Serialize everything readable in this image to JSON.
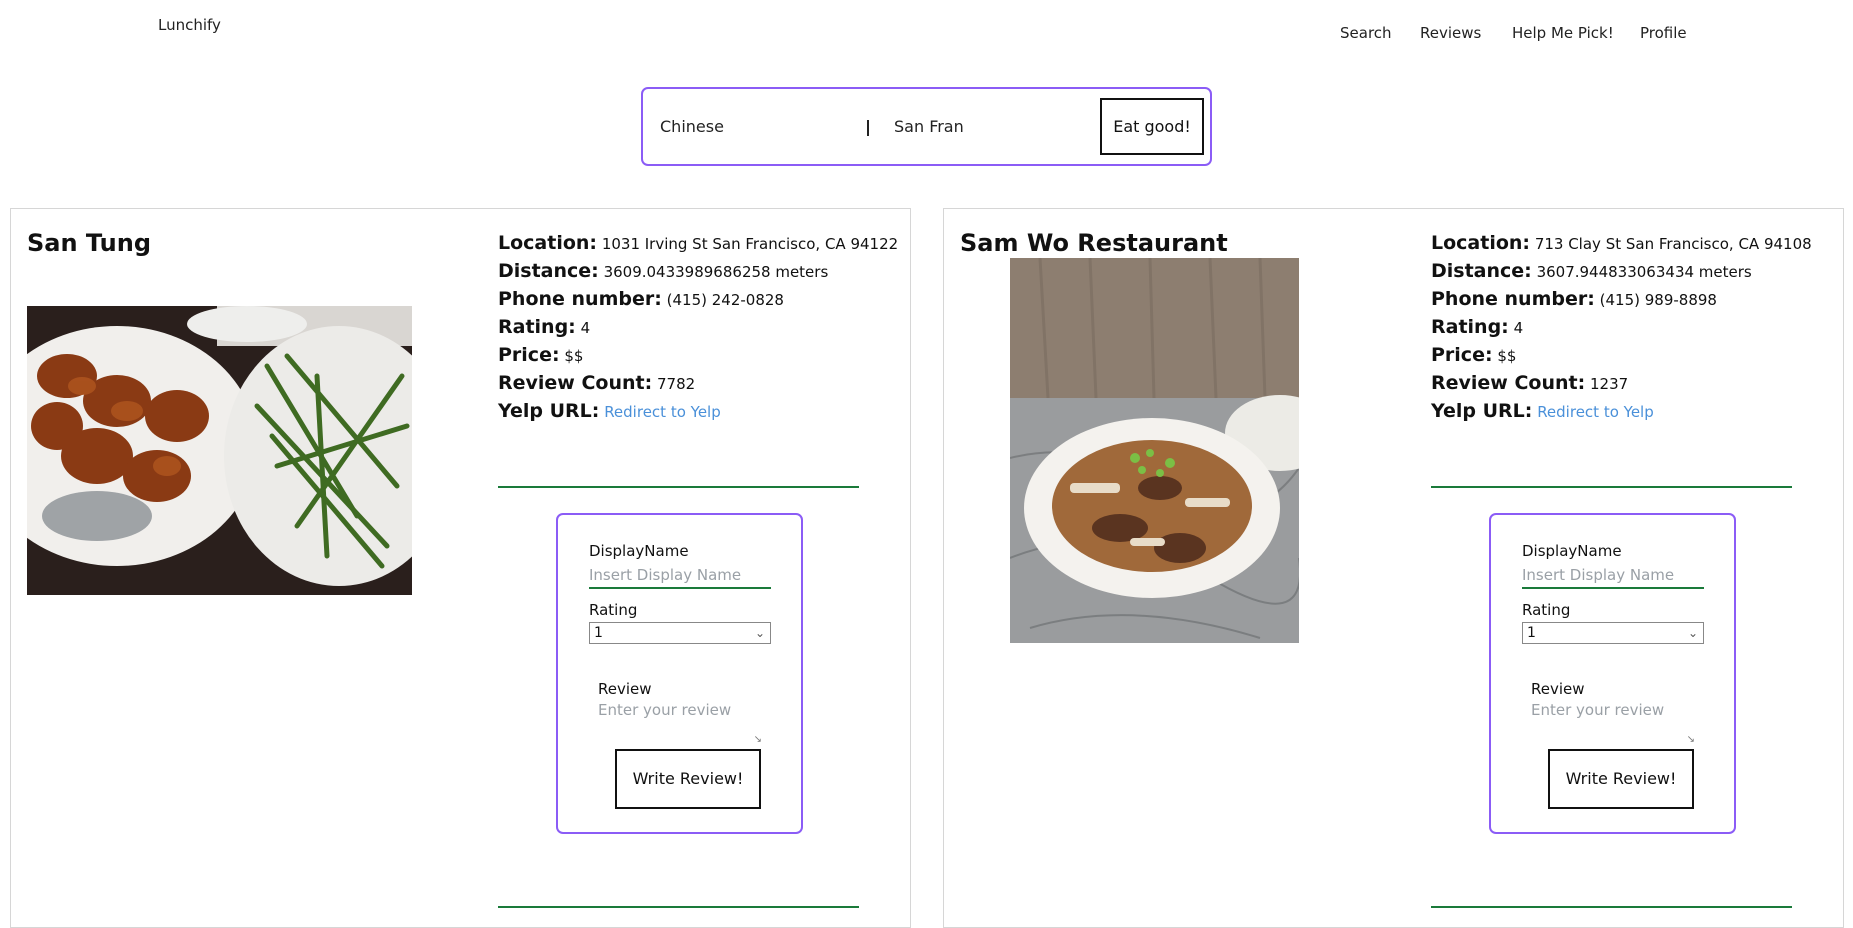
{
  "app": {
    "title": "Lunchify"
  },
  "nav": {
    "items": [
      "Search",
      "Reviews",
      "Help Me Pick!",
      "Profile"
    ]
  },
  "search": {
    "term": "Chinese",
    "location": "San Fran",
    "button_label": "Eat good!"
  },
  "labels": {
    "location": "Location:",
    "distance": "Distance:",
    "phone": "Phone number:",
    "rating": "Rating:",
    "price": "Price:",
    "review_count": "Review Count:",
    "yelp": "Yelp URL:"
  },
  "restaurants": [
    {
      "name": "San Tung",
      "location": "1031 Irving St San Francisco, CA 94122",
      "distance": "3609.0433989686258 meters",
      "phone": "(415) 242-0828",
      "rating": "4",
      "price": "$$",
      "review_count": "7782",
      "yelp_link": "Redirect to Yelp",
      "image": "fried-chicken-wings-and-green-beans-photo"
    },
    {
      "name": "Sam Wo Restaurant",
      "location": "713 Clay St San Francisco, CA 94108",
      "distance": "3607.944833063434 meters",
      "phone": "(415) 989-8898",
      "rating": "4",
      "price": "$$",
      "review_count": "1237",
      "yelp_link": "Redirect to Yelp",
      "image": "chow-fun-noodle-plate-photo"
    }
  ],
  "review_form": {
    "display_name_label": "DisplayName",
    "display_name_placeholder": "Insert Display Name",
    "rating_label": "Rating",
    "rating_value": "1",
    "review_label": "Review",
    "review_placeholder": "Enter your review",
    "submit_label": "Write Review!"
  },
  "colors": {
    "accent_border": "#8b5cf6",
    "rule": "#1a7a3a",
    "link": "#4a90d9"
  }
}
